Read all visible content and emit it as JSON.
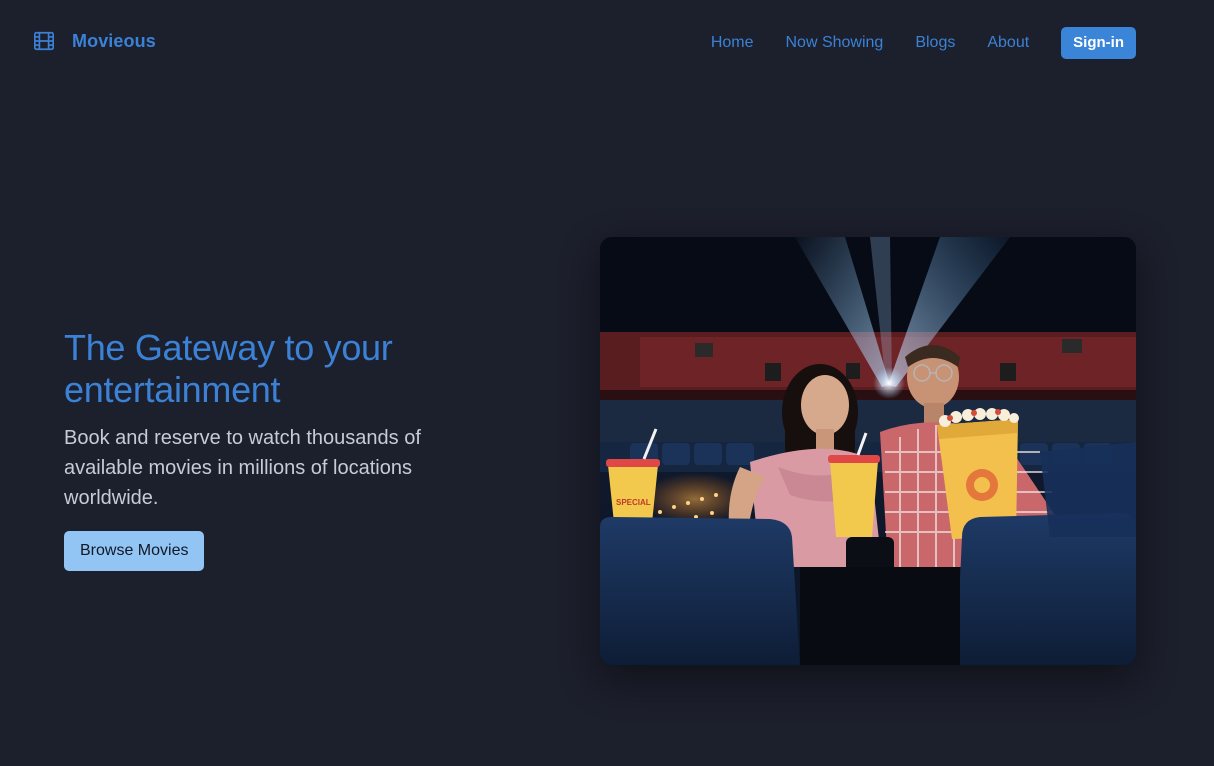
{
  "brand": {
    "name": "Movieous",
    "icon": "film-icon"
  },
  "nav": {
    "items": [
      {
        "label": "Home"
      },
      {
        "label": "Now Showing"
      },
      {
        "label": "Blogs"
      },
      {
        "label": "About"
      }
    ],
    "signin_label": "Sign-in"
  },
  "hero": {
    "title": "The Gateway to your entertainment",
    "subtitle": "Book and reserve to watch thousands of available movies in millions of locations worldwide.",
    "cta_label": "Browse Movies"
  },
  "colors": {
    "background": "#1c1f2c",
    "accent": "#3b82d6",
    "cta": "#93c5f4"
  }
}
